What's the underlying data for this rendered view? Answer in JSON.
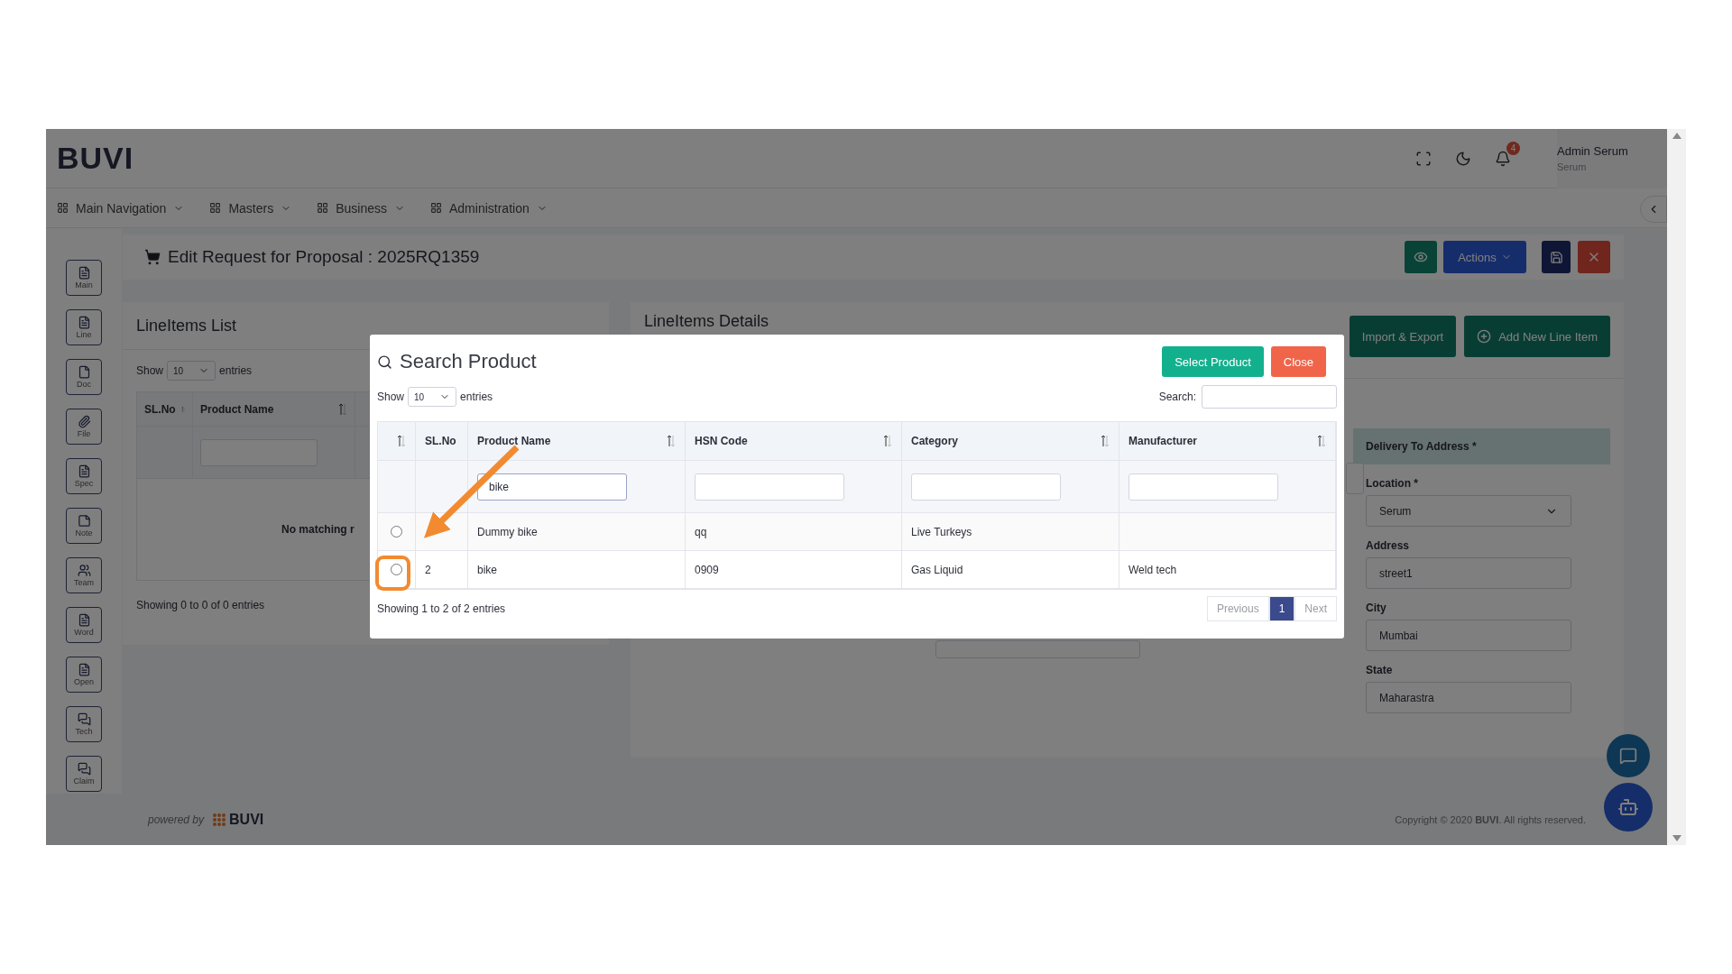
{
  "header": {
    "logo": "BUVI",
    "notification_count": "4",
    "user": {
      "name": "Admin Serum",
      "org": "Serum"
    }
  },
  "nav": [
    {
      "label": "Main Navigation"
    },
    {
      "label": "Masters"
    },
    {
      "label": "Business"
    },
    {
      "label": "Administration"
    }
  ],
  "page": {
    "title": "Edit Request for Proposal : 2025RQ1359",
    "actions_label": "Actions"
  },
  "side_tools": [
    {
      "label": "Main"
    },
    {
      "label": "Line"
    },
    {
      "label": "Doc"
    },
    {
      "label": "File"
    },
    {
      "label": "Spec"
    },
    {
      "label": "Note"
    },
    {
      "label": "Team"
    },
    {
      "label": "Word"
    },
    {
      "label": "Open"
    },
    {
      "label": "Tech"
    },
    {
      "label": "Claim"
    }
  ],
  "lineitems_list": {
    "title": "LineItems List",
    "show_label": "Show",
    "page_size": "10",
    "entries_label": "entries",
    "columns": [
      {
        "label": "SL.No",
        "sortable": true,
        "filterable": false
      },
      {
        "label": "Product Name",
        "sortable": true,
        "filterable": true
      }
    ],
    "empty_message": "No matching r",
    "info": "Showing 0 to 0 of 0 entries"
  },
  "lineitems_details": {
    "title": "LineItems Details",
    "buttons": [
      {
        "label": "Import & Export",
        "kind": "plain"
      },
      {
        "label": "Add New Line Item",
        "kind": "add"
      }
    ],
    "delivery": {
      "heading": "Delivery To Address *",
      "fields": [
        {
          "label": "Location *",
          "value": "Serum",
          "kind": "select"
        },
        {
          "label": "Address",
          "value": "street1",
          "kind": "text"
        },
        {
          "label": "City",
          "value": "Mumbai",
          "kind": "text"
        },
        {
          "label": "State",
          "value": "Maharastra",
          "kind": "text"
        }
      ]
    }
  },
  "modal": {
    "title": "Search Product",
    "buttons": [
      {
        "label": "Select Product",
        "kind": "primary"
      },
      {
        "label": "Close",
        "kind": "danger"
      }
    ],
    "show_label": "Show",
    "page_size": "10",
    "entries_label": "entries",
    "search_label": "Search:",
    "columns": [
      {
        "sortable": true
      },
      {
        "label": "SL.No",
        "sortable": false,
        "filterable": false
      },
      {
        "label": "Product Name",
        "sortable": true,
        "filterable": true,
        "filter": "bike"
      },
      {
        "label": "HSN Code",
        "sortable": true,
        "filterable": true
      },
      {
        "label": "Category",
        "sortable": true,
        "filterable": true
      },
      {
        "label": "Manufacturer",
        "sortable": true,
        "filterable": true
      }
    ],
    "rows": [
      {
        "selected": false,
        "cells": [
          null,
          null,
          "Dummy bike",
          "qq",
          "Live Turkeys",
          null
        ]
      },
      {
        "selected": false,
        "cells": [
          null,
          "2",
          "bike",
          "0909",
          "Gas Liquid",
          "Weld tech"
        ]
      }
    ],
    "info": "Showing 1 to 2 of 2 entries",
    "pagination": [
      {
        "label": "Previous",
        "selected": false,
        "disabled": true
      },
      {
        "label": "1",
        "selected": true,
        "disabled": false
      },
      {
        "label": "Next",
        "selected": false,
        "disabled": true
      }
    ]
  },
  "footer": {
    "powered_by": "powered by",
    "brand": "BUVI",
    "copyright": "Copyright © 2020 **BUVI**. All rights reserved."
  }
}
